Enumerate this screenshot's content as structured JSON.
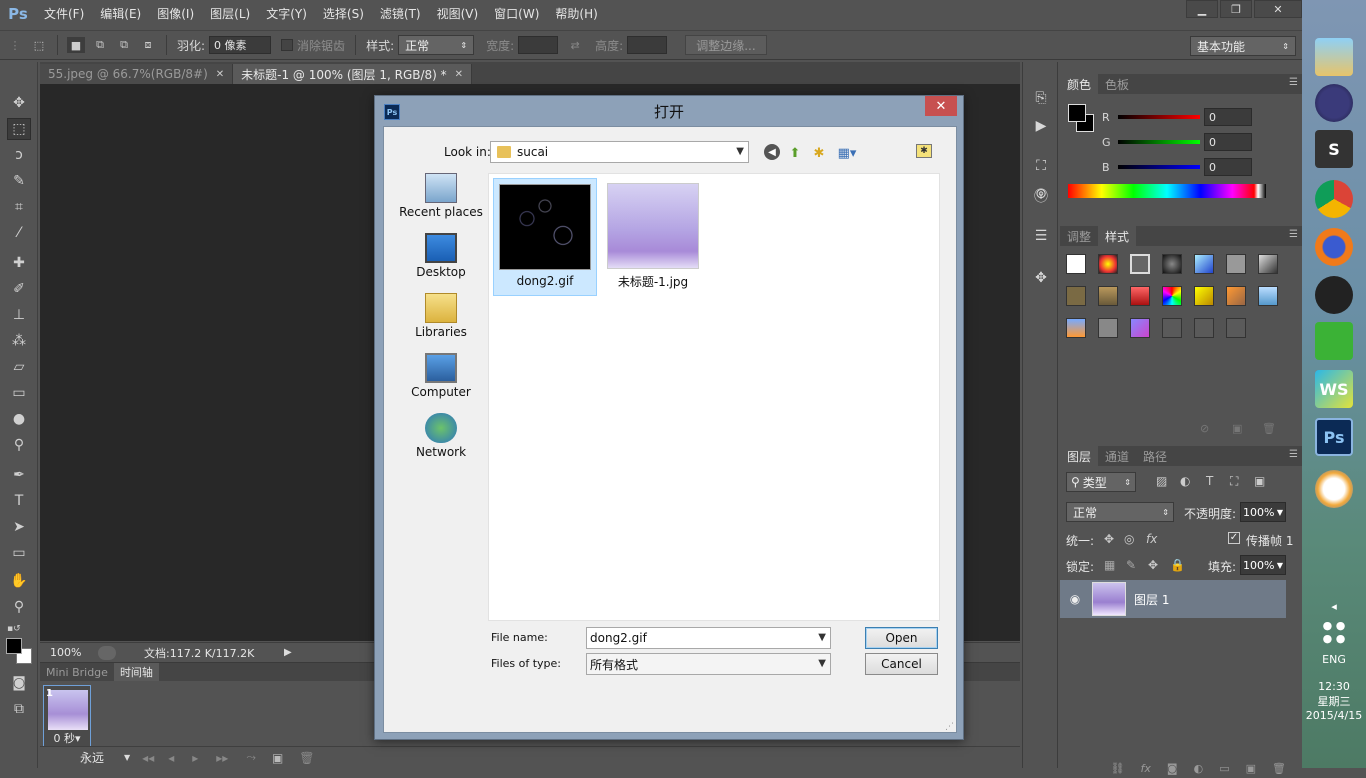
{
  "app": {
    "logo": "Ps",
    "menu": [
      "文件(F)",
      "编辑(E)",
      "图像(I)",
      "图层(L)",
      "文字(Y)",
      "选择(S)",
      "滤镜(T)",
      "视图(V)",
      "窗口(W)",
      "帮助(H)"
    ],
    "window_controls": {
      "minimize": "▁",
      "restore": "❐",
      "close": "✕"
    }
  },
  "options_bar": {
    "feather_label": "羽化:",
    "feather_value": "0 像素",
    "antialias_label": "消除锯齿",
    "style_label": "样式:",
    "style_value": "正常",
    "width_label": "宽度:",
    "height_label": "高度:",
    "refine_edge": "调整边缘...",
    "workspace": "基本功能"
  },
  "doc_tabs": [
    {
      "label": "55.jpeg @ 66.7%(RGB/8#)",
      "close": "✕"
    },
    {
      "label": "未标题-1 @ 100% (图层 1, RGB/8) *",
      "close": "✕"
    }
  ],
  "status": {
    "zoom": "100%",
    "doc_info": "文档:117.2 K/117.2K"
  },
  "timeline": {
    "tabs": [
      "Mini Bridge",
      "时间轴"
    ],
    "frame_number": "1",
    "frame_time": "0 秒▾",
    "loop": "永远"
  },
  "color_panel": {
    "tabs": [
      "颜色",
      "色板"
    ],
    "r_label": "R",
    "r_value": "0",
    "g_label": "G",
    "g_value": "0",
    "b_label": "B",
    "b_value": "0"
  },
  "styles_panel": {
    "tabs": [
      "调整",
      "样式"
    ]
  },
  "layers_panel": {
    "tabs": [
      "图层",
      "通道",
      "路径"
    ],
    "filter_kind": "类型",
    "blend_mode": "正常",
    "opacity_label": "不透明度:",
    "opacity_value": "100%",
    "unify_label": "统一:",
    "propagate_label": "传播帧 1",
    "lock_label": "锁定:",
    "fill_label": "填充:",
    "fill_value": "100%",
    "layer_name": "图层 1"
  },
  "dialog": {
    "title": "打开",
    "close": "✕",
    "look_in_label": "Look in:",
    "look_in_value": "sucai",
    "places": [
      "Recent places",
      "Desktop",
      "Libraries",
      "Computer",
      "Network"
    ],
    "files": [
      {
        "name": "dong2.gif",
        "selected": true
      },
      {
        "name": "未标题-1.jpg",
        "selected": false
      }
    ],
    "file_name_label": "File name:",
    "file_name_value": "dong2.gif",
    "file_type_label": "Files of type:",
    "file_type_value": "所有格式",
    "open_button": "Open",
    "cancel_button": "Cancel"
  },
  "taskbar": {
    "ps_icon": "Ps",
    "ws_icon": "WS",
    "lang": "ENG",
    "time": "12:30",
    "weekday": "星期三",
    "date": "2015/4/15"
  }
}
